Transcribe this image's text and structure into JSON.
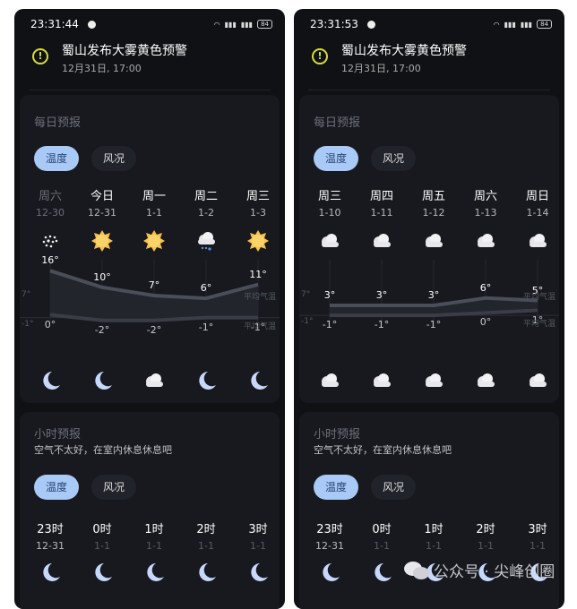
{
  "colors": {
    "accent": "#a9c9f7",
    "warning": "#d8dc3a",
    "background": "#0f1115",
    "card": "#17191e"
  },
  "phones": [
    {
      "status": {
        "time": "23:31:44",
        "battery": "84",
        "icons": [
          "wifi-icon",
          "signal-icon",
          "signal-icon"
        ]
      },
      "alert": {
        "icon": "warning-icon",
        "title": "蜀山发布大雾黄色预警",
        "time": "12月31日, 17:00"
      },
      "daily": {
        "title": "每日预报",
        "tabs": [
          {
            "label": "温度",
            "active": true
          },
          {
            "label": "风况",
            "active": false
          }
        ],
        "days": [
          {
            "name": "周六",
            "date": "12-30",
            "day_icon": "snow",
            "night_icon": "moon",
            "past": true
          },
          {
            "name": "今日",
            "date": "12-31",
            "day_icon": "sun",
            "night_icon": "moon"
          },
          {
            "name": "周一",
            "date": "1-1",
            "day_icon": "sun",
            "night_icon": "cloud"
          },
          {
            "name": "周二",
            "date": "1-2",
            "day_icon": "rain",
            "night_icon": "moon"
          },
          {
            "name": "周三",
            "date": "1-3",
            "day_icon": "sun",
            "night_icon": "moon"
          }
        ],
        "chart_data": {
          "type": "line",
          "highs": [
            16,
            10,
            7,
            6,
            11
          ],
          "lows": [
            0,
            -2,
            -2,
            -1,
            -1
          ],
          "ylim": [
            -6,
            20
          ],
          "high_labels": [
            "16°",
            "10°",
            "7°",
            "6°",
            "11°"
          ],
          "low_labels": [
            "0°",
            "-2°",
            "-2°",
            "-1°",
            "-1°"
          ],
          "avg_high": "7°",
          "avg_low": "-1°",
          "avg_label": "平均气温"
        }
      },
      "hourly": {
        "title": "小时预报",
        "subtitle": "空气不太好，在室内休息休息吧",
        "tabs": [
          {
            "label": "温度",
            "active": true
          },
          {
            "label": "风况",
            "active": false
          }
        ],
        "hours": [
          {
            "name": "23时",
            "date": "12-31",
            "icon": "moon"
          },
          {
            "name": "0时",
            "date": "1-1",
            "icon": "moon"
          },
          {
            "name": "1时",
            "date": "1-1",
            "icon": "moon"
          },
          {
            "name": "2时",
            "date": "1-1",
            "icon": "moon"
          },
          {
            "name": "3时",
            "date": "1-1",
            "icon": "moon"
          }
        ]
      }
    },
    {
      "status": {
        "time": "23:31:53",
        "battery": "84",
        "icons": [
          "wifi-icon",
          "signal-icon",
          "signal-icon"
        ]
      },
      "alert": {
        "icon": "warning-icon",
        "title": "蜀山发布大雾黄色预警",
        "time": "12月31日, 17:00"
      },
      "daily": {
        "title": "每日预报",
        "tabs": [
          {
            "label": "温度",
            "active": true
          },
          {
            "label": "风况",
            "active": false
          }
        ],
        "days": [
          {
            "name": "周三",
            "date": "1-10",
            "day_icon": "cloud",
            "night_icon": "cloud"
          },
          {
            "name": "周四",
            "date": "1-11",
            "day_icon": "cloud",
            "night_icon": "cloud"
          },
          {
            "name": "周五",
            "date": "1-12",
            "day_icon": "cloud",
            "night_icon": "cloud"
          },
          {
            "name": "周六",
            "date": "1-13",
            "day_icon": "cloud",
            "night_icon": "cloud"
          },
          {
            "name": "周日",
            "date": "1-14",
            "day_icon": "cloud",
            "night_icon": "cloud"
          }
        ],
        "chart_data": {
          "type": "line",
          "highs": [
            3,
            3,
            3,
            6,
            5
          ],
          "lows": [
            -1,
            -1,
            -1,
            0,
            1
          ],
          "ylim": [
            -7.5,
            21.5
          ],
          "high_labels": [
            "3°",
            "3°",
            "3°",
            "6°",
            "5°"
          ],
          "low_labels": [
            "-1°",
            "-1°",
            "-1°",
            "0°",
            "1°"
          ],
          "avg_high": "7°",
          "avg_low": "-1°",
          "avg_label": "平均气温"
        }
      },
      "hourly": {
        "title": "小时预报",
        "subtitle": "空气不太好，在室内休息休息吧",
        "tabs": [
          {
            "label": "温度",
            "active": true
          },
          {
            "label": "风况",
            "active": false
          }
        ],
        "hours": [
          {
            "name": "23时",
            "date": "12-31",
            "icon": "moon"
          },
          {
            "name": "0时",
            "date": "1-1",
            "icon": "moon"
          },
          {
            "name": "1时",
            "date": "1-1",
            "icon": "moon"
          },
          {
            "name": "2时",
            "date": "1-1",
            "icon": "moon"
          },
          {
            "name": "3时",
            "date": "1-1",
            "icon": "moon"
          }
        ]
      }
    }
  ],
  "watermark": {
    "text": "公众号 · 尖峰创圈"
  }
}
